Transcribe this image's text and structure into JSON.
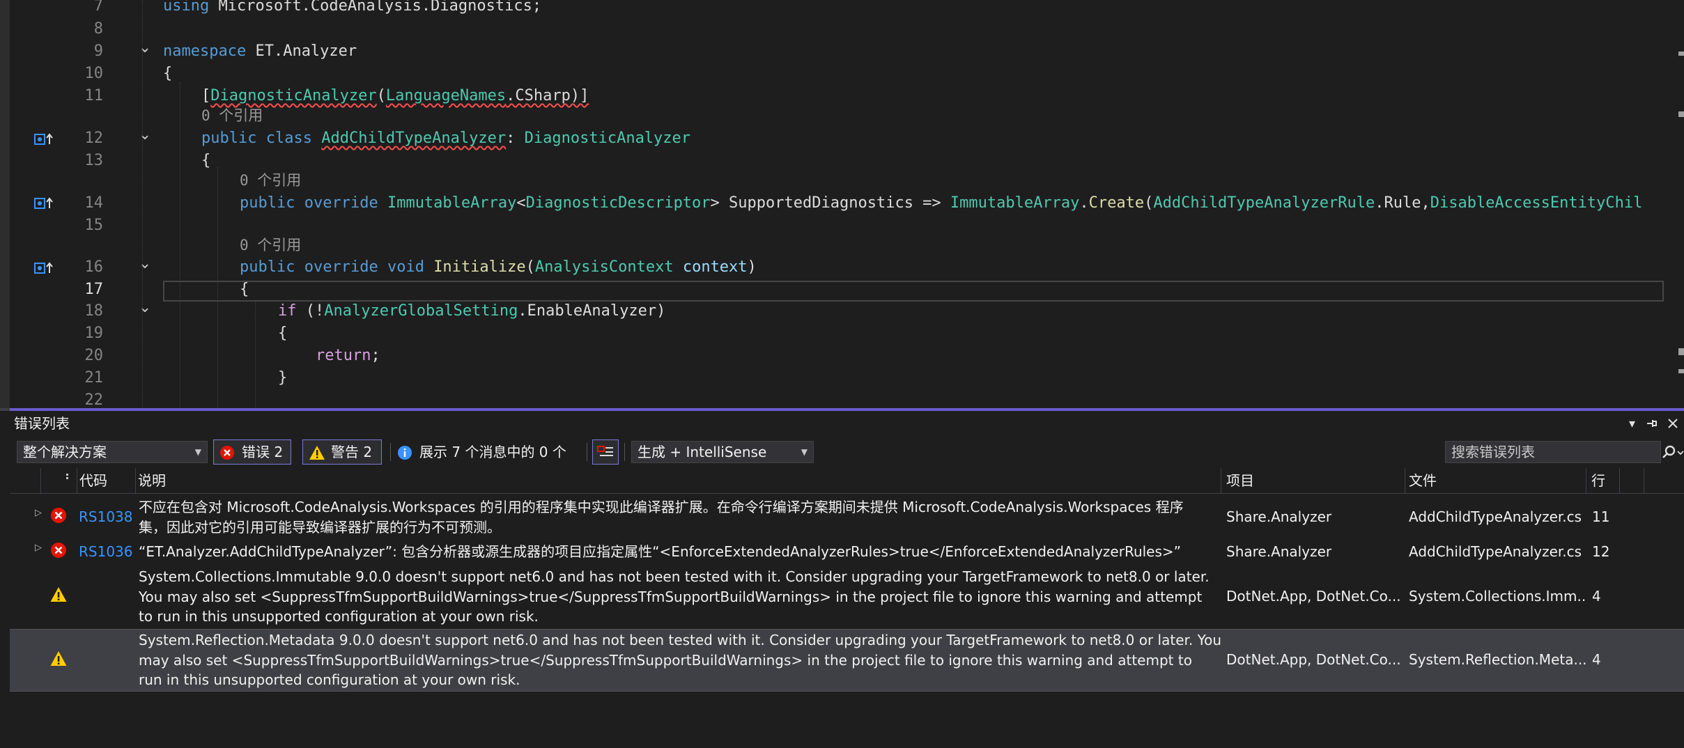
{
  "editor": {
    "lines": [
      {
        "num": "7",
        "segments": [
          {
            "t": "using",
            "c": "kw"
          },
          {
            "t": " Microsoft.CodeAnalysis.Diagnostics;",
            "c": "id"
          }
        ]
      },
      {
        "num": "8",
        "segments": []
      },
      {
        "num": "9",
        "segments": [
          {
            "t": "namespace",
            "c": "kw"
          },
          {
            "t": " ET.Analyzer",
            "c": "id"
          }
        ]
      },
      {
        "num": "10",
        "segments": [
          {
            "t": "{",
            "c": "id"
          }
        ]
      },
      {
        "num": "11",
        "segments": [
          {
            "t": "[",
            "c": "id"
          },
          {
            "t": "DiagnosticAnalyzer",
            "c": "ty sq"
          },
          {
            "t": "(",
            "c": "id"
          },
          {
            "t": "LanguageNames",
            "c": "ty sq"
          },
          {
            "t": ".CSharp)]",
            "c": "id sq"
          }
        ]
      },
      {
        "num": "12",
        "segments": [
          {
            "t": "public",
            "c": "kw"
          },
          {
            "t": " ",
            "c": "id"
          },
          {
            "t": "class",
            "c": "kw"
          },
          {
            "t": " ",
            "c": "id"
          },
          {
            "t": "AddChildTypeAnalyzer",
            "c": "ty sq"
          },
          {
            "t": ": ",
            "c": "id"
          },
          {
            "t": "DiagnosticAnalyzer",
            "c": "ty"
          }
        ]
      },
      {
        "num": "13",
        "segments": [
          {
            "t": "{",
            "c": "id"
          }
        ]
      },
      {
        "num": "14",
        "segments": [
          {
            "t": "public",
            "c": "kw"
          },
          {
            "t": " ",
            "c": "id"
          },
          {
            "t": "override",
            "c": "kw"
          },
          {
            "t": " ",
            "c": "id"
          },
          {
            "t": "ImmutableArray",
            "c": "ty"
          },
          {
            "t": "<",
            "c": "id"
          },
          {
            "t": "DiagnosticDescriptor",
            "c": "ty"
          },
          {
            "t": "> SupportedDiagnostics => ",
            "c": "id"
          },
          {
            "t": "ImmutableArray",
            "c": "ty"
          },
          {
            "t": ".",
            "c": "id"
          },
          {
            "t": "Create",
            "c": "fn"
          },
          {
            "t": "(",
            "c": "id"
          },
          {
            "t": "AddChildTypeAnalyzerRule",
            "c": "ty"
          },
          {
            "t": ".Rule,",
            "c": "id"
          },
          {
            "t": "DisableAccessEntityChil",
            "c": "ty"
          }
        ]
      },
      {
        "num": "15",
        "segments": []
      },
      {
        "num": "16",
        "segments": [
          {
            "t": "public",
            "c": "kw"
          },
          {
            "t": " ",
            "c": "id"
          },
          {
            "t": "override",
            "c": "kw"
          },
          {
            "t": " ",
            "c": "id"
          },
          {
            "t": "void",
            "c": "kw"
          },
          {
            "t": " ",
            "c": "id"
          },
          {
            "t": "Initialize",
            "c": "fn"
          },
          {
            "t": "(",
            "c": "id"
          },
          {
            "t": "AnalysisContext",
            "c": "ty"
          },
          {
            "t": " ",
            "c": "id"
          },
          {
            "t": "context",
            "c": "pm"
          },
          {
            "t": ")",
            "c": "id"
          }
        ]
      },
      {
        "num": "17",
        "segments": [
          {
            "t": "{",
            "c": "id"
          }
        ]
      },
      {
        "num": "18",
        "segments": [
          {
            "t": "if",
            "c": "ctl"
          },
          {
            "t": " (!",
            "c": "id"
          },
          {
            "t": "AnalyzerGlobalSetting",
            "c": "ty"
          },
          {
            "t": ".EnableAnalyzer)",
            "c": "id"
          }
        ]
      },
      {
        "num": "19",
        "segments": [
          {
            "t": "{",
            "c": "id"
          }
        ]
      },
      {
        "num": "20",
        "segments": [
          {
            "t": "return",
            "c": "ctl"
          },
          {
            "t": ";",
            "c": "id"
          }
        ]
      },
      {
        "num": "21",
        "segments": [
          {
            "t": "}",
            "c": "id"
          }
        ]
      },
      {
        "num": "22",
        "segments": []
      }
    ],
    "codelens_label": "0 个引用"
  },
  "error_list": {
    "title": "错误列表",
    "scope_select": "整个解决方案",
    "errors_button": "错误 2",
    "warnings_button": "警告 2",
    "messages_text": "展示 7 个消息中的 0 个",
    "build_select": "生成 + IntelliSense",
    "search_placeholder": "搜索错误列表",
    "columns": {
      "code": "代码",
      "description": "说明",
      "project": "项目",
      "file": "文件",
      "line": "行"
    },
    "rows": [
      {
        "severity": "error",
        "code": "RS1038",
        "desc_lines": [
          "不应在包含对 Microsoft.CodeAnalysis.Workspaces 的引用的程序集中实现此编译器扩展。在命令行编译方案期间未提供 Microsoft.CodeAnalysis.Workspaces 程序",
          "集，因此对它的引用可能导致编译器扩展的行为不可预测。"
        ],
        "project": "Share.Analyzer",
        "file": "AddChildTypeAnalyzer.cs",
        "line": "11"
      },
      {
        "severity": "error",
        "code": "RS1036",
        "desc_lines": [
          "“ET.Analyzer.AddChildTypeAnalyzer”: 包含分析器或源生成器的项目应指定属性“<EnforceExtendedAnalyzerRules>true</EnforceExtendedAnalyzerRules>”"
        ],
        "project": "Share.Analyzer",
        "file": "AddChildTypeAnalyzer.cs",
        "line": "12"
      },
      {
        "severity": "warning",
        "code": "",
        "desc_lines": [
          "System.Collections.Immutable 9.0.0 doesn't support net6.0 and has not been tested with it. Consider upgrading your TargetFramework to net8.0 or later.",
          "You may also set <SuppressTfmSupportBuildWarnings>true</SuppressTfmSupportBuildWarnings> in the project file to ignore this warning and attempt",
          "to run in this unsupported configuration at your own risk."
        ],
        "project": "DotNet.App, DotNet.Co...",
        "file": "System.Collections.Imm...",
        "line": "4"
      },
      {
        "severity": "warning",
        "code": "",
        "desc_lines": [
          "System.Reflection.Metadata 9.0.0 doesn't support net6.0 and has not been tested with it. Consider upgrading your TargetFramework to net8.0 or later. You",
          "may also set <SuppressTfmSupportBuildWarnings>true</SuppressTfmSupportBuildWarnings> in the project file to ignore this warning and attempt to",
          "run in this unsupported configuration at your own risk."
        ],
        "project": "DotNet.App, DotNet.Co...",
        "file": "System.Reflection.Meta...",
        "line": "4"
      }
    ]
  },
  "colors": {
    "accent": "#6a5acd",
    "error": "#e51400",
    "warning": "#ffcc00",
    "link": "#3794ff"
  }
}
